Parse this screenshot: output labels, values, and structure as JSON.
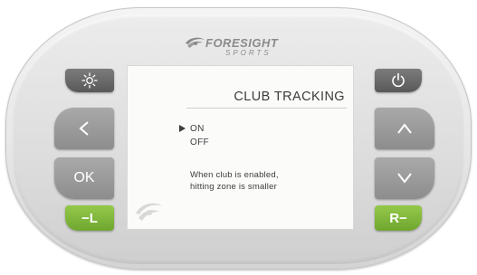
{
  "brand": {
    "name": "FORESIGHT",
    "subtitle": "SPORTS"
  },
  "screen": {
    "title": "CLUB TRACKING",
    "options": [
      {
        "label": "ON",
        "selected": true
      },
      {
        "label": "OFF",
        "selected": false
      }
    ],
    "help_line1": "When club is enabled,",
    "help_line2": "hitting zone is smaller"
  },
  "buttons": {
    "left_side": [
      {
        "id": "brightness",
        "icon": "sun-icon"
      },
      {
        "id": "back",
        "label": "<"
      },
      {
        "id": "ok",
        "label": "OK"
      },
      {
        "id": "left-minus",
        "label": "−L"
      }
    ],
    "right_side": [
      {
        "id": "power",
        "icon": "power-icon"
      },
      {
        "id": "up",
        "label": "∧"
      },
      {
        "id": "down",
        "label": "∨"
      },
      {
        "id": "right-minus",
        "label": "R−"
      }
    ]
  },
  "colors": {
    "button_dark": "#6a6a6a",
    "button_grey": "#9b9b9b",
    "button_green": "#7fb83b",
    "screen_bg": "#fbfbfa",
    "text": "#3d3d3d"
  }
}
